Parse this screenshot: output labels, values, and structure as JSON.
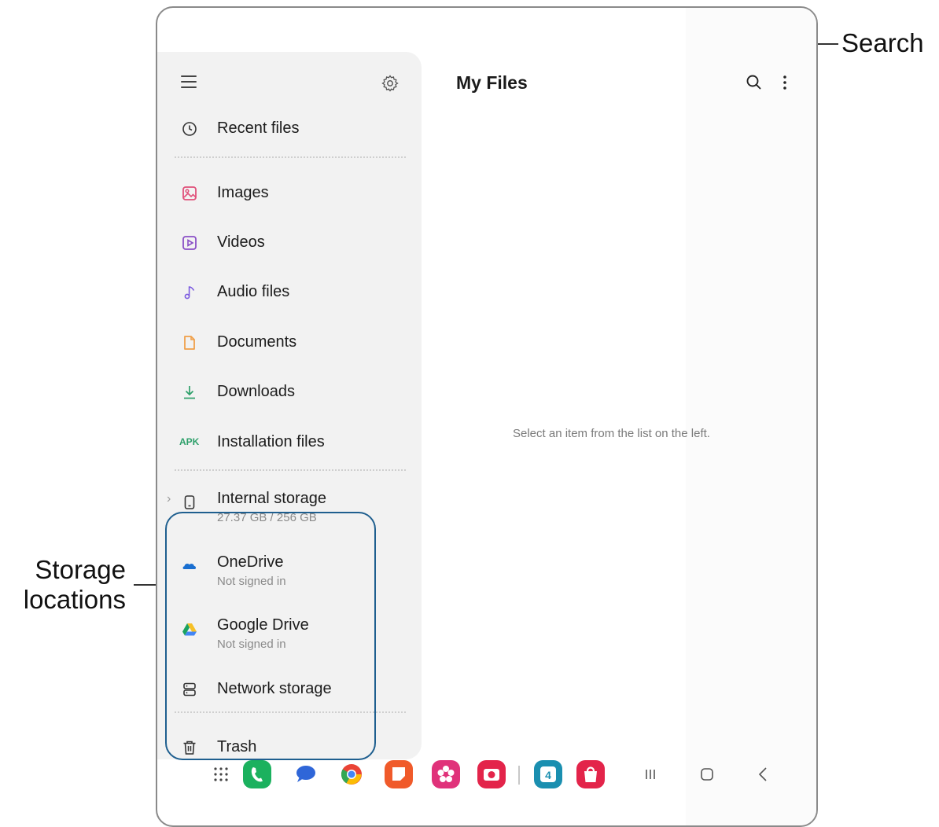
{
  "header": {
    "title": "My Files",
    "search_icon": "search-icon",
    "more_icon": "more-options-icon"
  },
  "sidebar": {
    "menu_icon": "hamburger-menu-icon",
    "settings_icon": "gear-icon",
    "items": [
      {
        "label": "Recent files",
        "icon": "clock-icon"
      },
      {
        "label": "Images",
        "icon": "image-icon",
        "color": "#e0507a"
      },
      {
        "label": "Videos",
        "icon": "video-icon",
        "color": "#8a4fc6"
      },
      {
        "label": "Audio files",
        "icon": "music-note-icon",
        "color": "#7b5ae0"
      },
      {
        "label": "Documents",
        "icon": "document-icon",
        "color": "#f0a04a"
      },
      {
        "label": "Downloads",
        "icon": "download-icon",
        "color": "#2fa06b"
      },
      {
        "label": "Installation files",
        "icon": "apk-icon",
        "badge": "APK",
        "color": "#2fa06b"
      }
    ],
    "storage": [
      {
        "label": "Internal storage",
        "sub": "27.37 GB / 256 GB",
        "icon": "phone-icon"
      },
      {
        "label": "OneDrive",
        "sub": "Not signed in",
        "icon": "onedrive-icon",
        "color": "#1a6fd0"
      },
      {
        "label": "Google Drive",
        "sub": "Not signed in",
        "icon": "google-drive-icon"
      },
      {
        "label": "Network storage",
        "icon": "network-storage-icon"
      }
    ],
    "trash": {
      "label": "Trash",
      "icon": "trash-icon"
    }
  },
  "main": {
    "empty_message": "Select an item from the list on the left."
  },
  "callouts": {
    "search": "Search",
    "storage_line1": "Storage",
    "storage_line2": "locations"
  },
  "dock": {
    "apps": [
      "apps-grid-icon",
      "phone-app-icon",
      "messages-app-icon",
      "chrome-app-icon",
      "notes-app-icon",
      "flower-app-icon",
      "camera-app-icon",
      "calendar-app-icon",
      "store-app-icon"
    ],
    "calendar_day": "4",
    "nav": [
      "recents-icon",
      "home-icon",
      "back-icon"
    ]
  }
}
